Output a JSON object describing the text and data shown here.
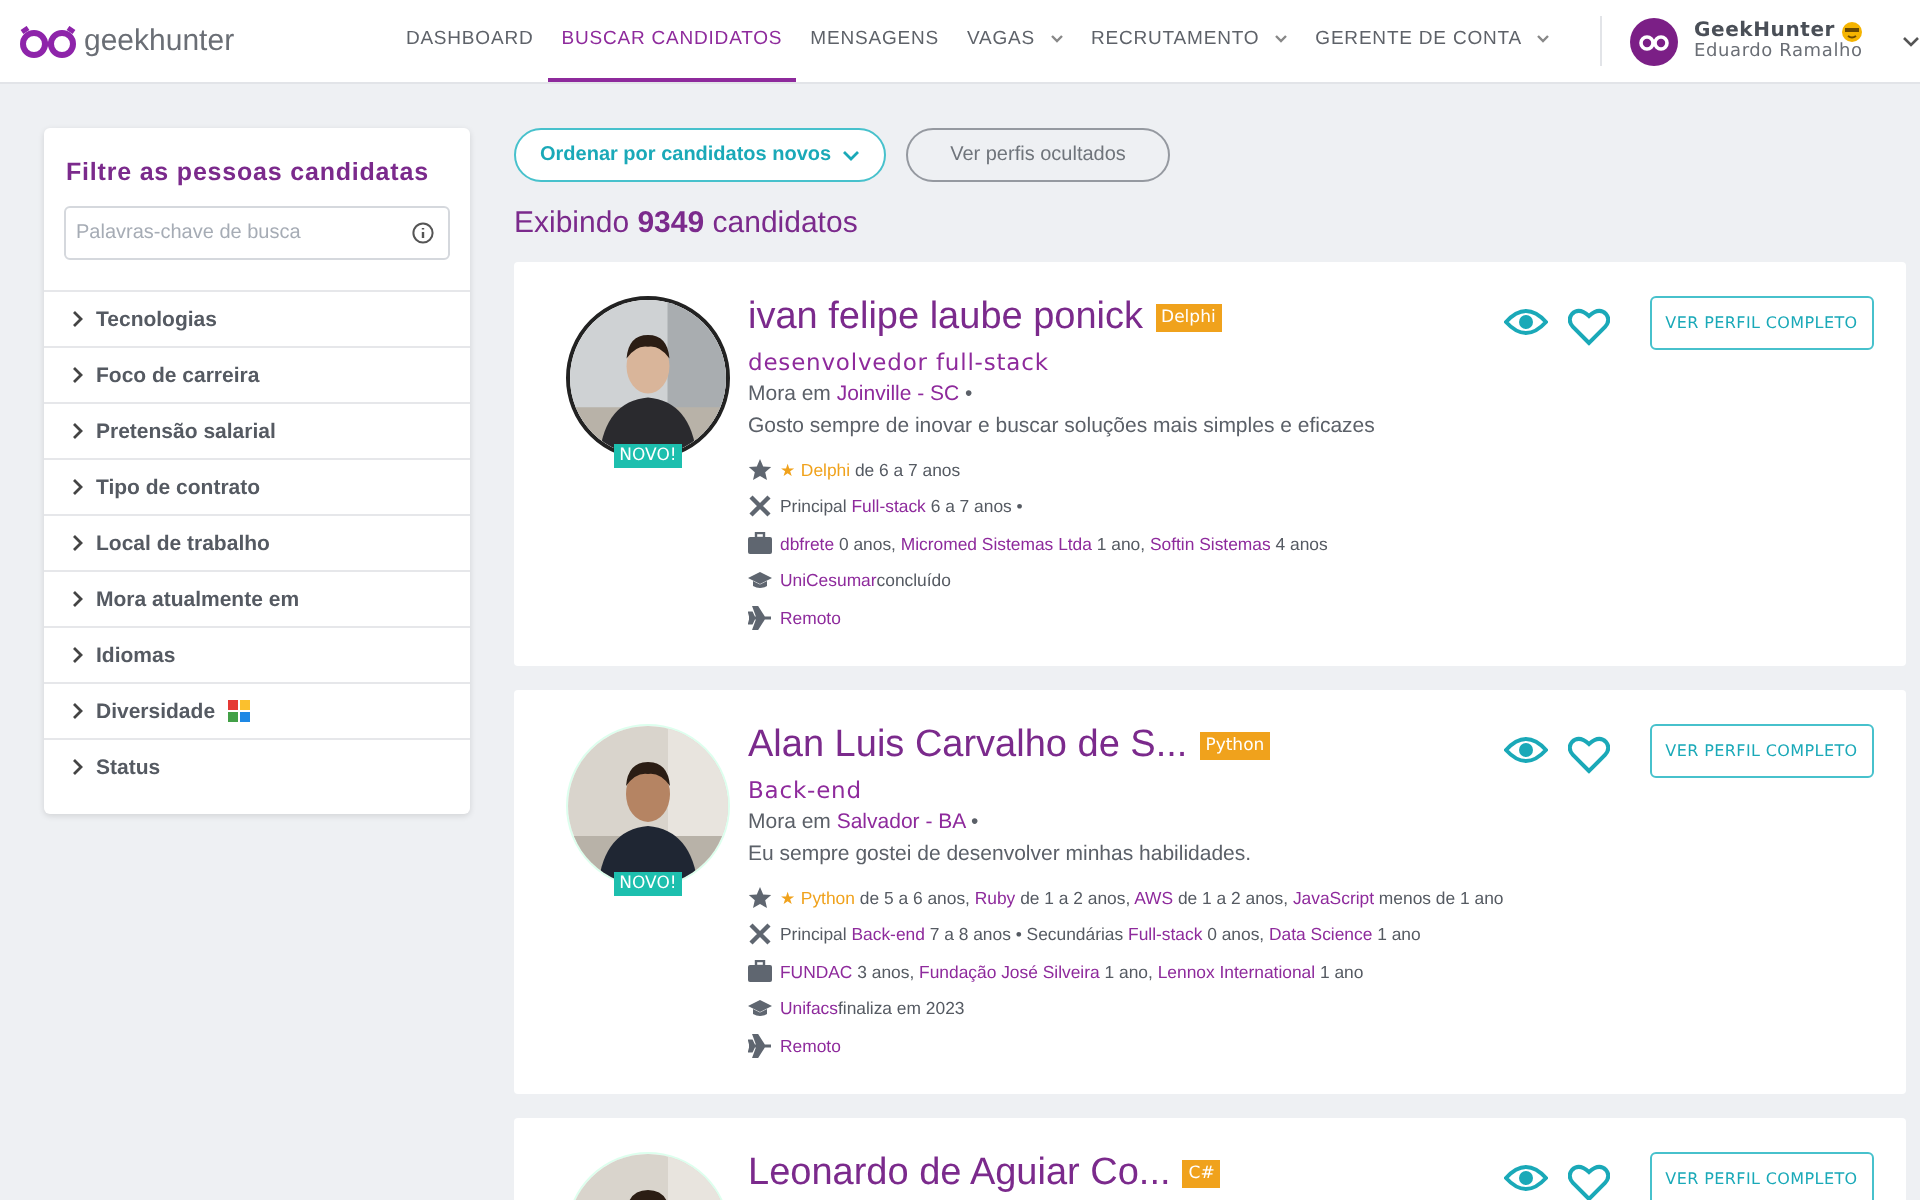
{
  "header": {
    "logo": "geekhunter",
    "nav": [
      {
        "label": "DASHBOARD",
        "selected": false,
        "dropdown": false
      },
      {
        "label": "BUSCAR CANDIDATOS",
        "selected": true,
        "dropdown": false
      },
      {
        "label": "MENSAGENS",
        "selected": false,
        "dropdown": false
      },
      {
        "label": "VAGAS",
        "selected": false,
        "dropdown": true
      },
      {
        "label": "RECRUTAMENTO",
        "selected": false,
        "dropdown": true
      },
      {
        "label": "GERENTE DE CONTA",
        "selected": false,
        "dropdown": true
      }
    ],
    "account": {
      "company": "GeekHunter",
      "user": "Eduardo Ramalho"
    }
  },
  "sidebar": {
    "title": "Filtre as pessoas candidatas",
    "search": {
      "placeholder": "Palavras-chave de busca"
    },
    "filters": [
      {
        "label": "Tecnologias",
        "expanded": false
      },
      {
        "label": "Foco de carreira",
        "expanded": false
      },
      {
        "label": "Pretensão salarial",
        "expanded": false
      },
      {
        "label": "Tipo de contrato",
        "expanded": false
      },
      {
        "label": "Local de trabalho",
        "expanded": false
      },
      {
        "label": "Mora atualmente em",
        "expanded": false
      },
      {
        "label": "Idiomas",
        "expanded": false
      },
      {
        "label": "Diversidade",
        "expanded": false,
        "icon": true
      },
      {
        "label": "Status",
        "expanded": false
      }
    ]
  },
  "toolbar": {
    "sort": "Ordenar por candidatos novos",
    "hidden_button": "Ver perfis ocultados"
  },
  "result_count": "Exibindo **9349** candidatos",
  "candidates": [
    {
      "name": "ivan felipe laube ponick",
      "tech": "Delphi",
      "new_badge": "NOVO!",
      "role": "desenvolvedor full-stack",
      "profile_button": "VER PERFIL COMPLETO",
      "location": [
        {
          "kind": "text",
          "text": "Mora em "
        },
        {
          "kind": "link",
          "text": "Joinville - SC"
        },
        {
          "kind": "text",
          "text": " •"
        }
      ],
      "bio": "Gosto sempre de inovar e buscar soluções mais simples e eficazes",
      "details": [
        {
          "kind": "star",
          "parts": [
            {
              "kind": "star",
              "text": "★ Delphi"
            },
            {
              "kind": "text",
              "text": " de 6 a 7 anos"
            }
          ]
        },
        {
          "kind": "tools",
          "parts": [
            {
              "kind": "text",
              "text": "Principal "
            },
            {
              "kind": "link",
              "text": "Full-stack"
            },
            {
              "kind": "text",
              "text": " 6 a 7 anos •"
            }
          ]
        },
        {
          "kind": "briefcase",
          "parts": [
            {
              "kind": "link",
              "text": "dbfrete"
            },
            {
              "kind": "text",
              "text": " 0 anos, "
            },
            {
              "kind": "link",
              "text": "Micromed Sistemas Ltda"
            },
            {
              "kind": "text",
              "text": " 1 ano, "
            },
            {
              "kind": "link",
              "text": "Softin Sistemas"
            },
            {
              "kind": "text",
              "text": " 4 anos"
            }
          ]
        },
        {
          "kind": "cap",
          "parts": [
            {
              "kind": "link",
              "text": "UniCesumar"
            },
            {
              "kind": "text",
              "text": "concluído"
            }
          ]
        },
        {
          "kind": "plane",
          "parts": [
            {
              "kind": "link",
              "text": "Remoto"
            }
          ]
        }
      ]
    },
    {
      "name": "Alan Luis Carvalho de S...",
      "tech": "Python",
      "new_badge": "NOVO!",
      "role": "Back-end",
      "profile_button": "VER PERFIL COMPLETO",
      "location": [
        {
          "kind": "text",
          "text": "Mora em "
        },
        {
          "kind": "link",
          "text": "Salvador - BA"
        },
        {
          "kind": "text",
          "text": " •"
        }
      ],
      "bio": "Eu sempre gostei de desenvolver minhas habilidades.",
      "details": [
        {
          "kind": "star",
          "parts": [
            {
              "kind": "star",
              "text": "★ Python"
            },
            {
              "kind": "text",
              "text": " de 5 a 6 anos, "
            },
            {
              "kind": "link",
              "text": "Ruby"
            },
            {
              "kind": "text",
              "text": " de 1 a 2 anos, "
            },
            {
              "kind": "link",
              "text": "AWS"
            },
            {
              "kind": "text",
              "text": " de 1 a 2 anos, "
            },
            {
              "kind": "link",
              "text": "JavaScript"
            },
            {
              "kind": "text",
              "text": " menos de 1 ano"
            }
          ]
        },
        {
          "kind": "tools",
          "parts": [
            {
              "kind": "text",
              "text": "Principal "
            },
            {
              "kind": "link",
              "text": "Back-end"
            },
            {
              "kind": "text",
              "text": " 7 a 8 anos • Secundárias "
            },
            {
              "kind": "link",
              "text": "Full-stack"
            },
            {
              "kind": "text",
              "text": " 0 anos, "
            },
            {
              "kind": "link",
              "text": "Data Science"
            },
            {
              "kind": "text",
              "text": " 1 ano"
            }
          ]
        },
        {
          "kind": "briefcase",
          "parts": [
            {
              "kind": "link",
              "text": "FUNDAC"
            },
            {
              "kind": "text",
              "text": " 3 anos, "
            },
            {
              "kind": "link",
              "text": "Fundação José Silveira"
            },
            {
              "kind": "text",
              "text": " 1 ano, "
            },
            {
              "kind": "link",
              "text": "Lennox International"
            },
            {
              "kind": "text",
              "text": " 1 ano"
            }
          ]
        },
        {
          "kind": "cap",
          "parts": [
            {
              "kind": "link",
              "text": "Unifacs"
            },
            {
              "kind": "text",
              "text": "finaliza em 2023"
            }
          ]
        },
        {
          "kind": "plane",
          "parts": [
            {
              "kind": "link",
              "text": "Remoto"
            }
          ]
        }
      ]
    },
    {
      "name": "Leonardo de Aguiar Co...",
      "tech": "C#",
      "profile_button": "VER PERFIL COMPLETO"
    }
  ]
}
